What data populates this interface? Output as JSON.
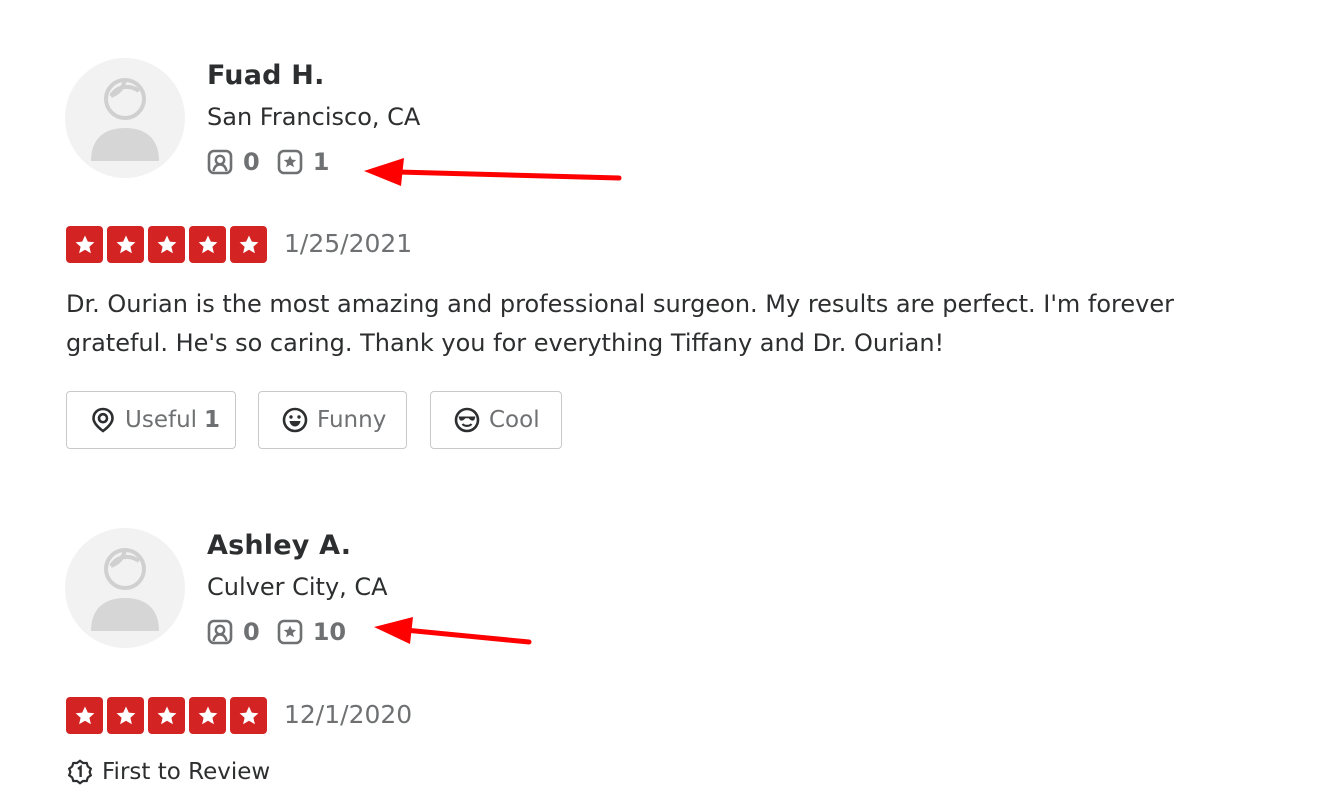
{
  "colors": {
    "star_red": "#d32323",
    "text_dark": "#2d2e2f",
    "text_gray": "#6e7072",
    "annotation_arrow": "#ff0000"
  },
  "reviews": [
    {
      "user": {
        "name": "Fuad H.",
        "location": "San Francisco, CA",
        "friends": "0",
        "review_count": "1",
        "avatar_icon": "default-user-avatar-icon"
      },
      "rating": 5,
      "date": "1/25/2021",
      "comment": "Dr. Ourian is the most amazing and professional surgeon. My results are perfect. I'm forever grateful. He's so caring. Thank you for everything Tiffany and Dr. Ourian!",
      "votes": {
        "useful_label": "Useful",
        "useful_count": "1",
        "funny_label": "Funny",
        "cool_label": "Cool"
      }
    },
    {
      "user": {
        "name": "Ashley A.",
        "location": "Culver City, CA",
        "friends": "0",
        "review_count": "10",
        "avatar_icon": "default-user-avatar-icon"
      },
      "rating": 5,
      "date": "12/1/2020",
      "badge": "First to Review"
    }
  ]
}
